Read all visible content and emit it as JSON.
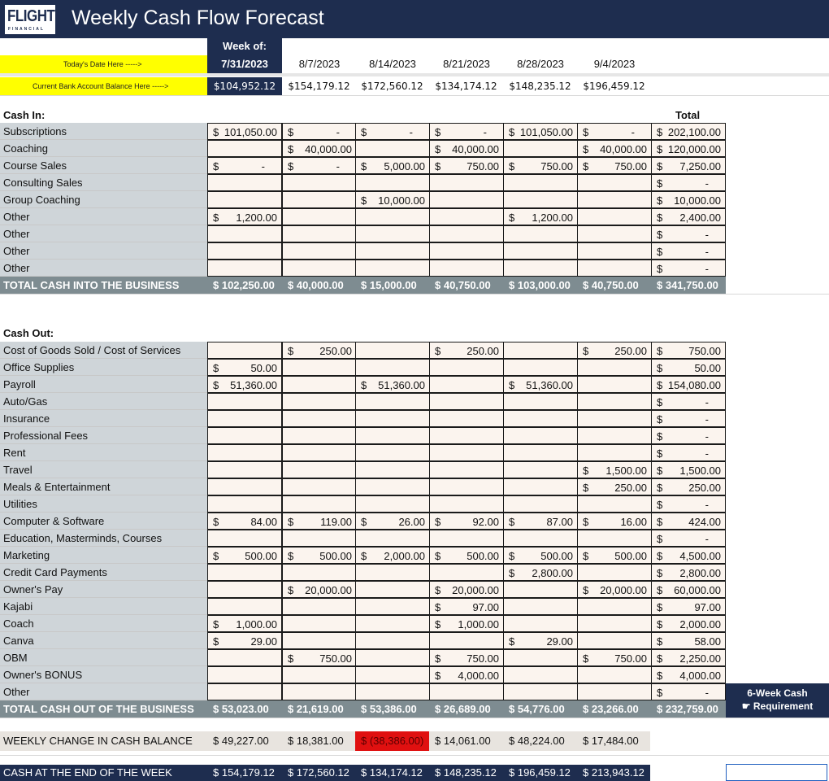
{
  "header": {
    "title": "Weekly Cash Flow Forecast",
    "logo_main": "FLIGHT",
    "logo_sub": "FINANCIAL"
  },
  "prompts": {
    "date": "Today's Date Here ----->",
    "balance": "Current Bank Account Balance Here ----->"
  },
  "week_of_label": "Week of:",
  "weeks": [
    "7/31/2023",
    "8/7/2023",
    "8/14/2023",
    "8/21/2023",
    "8/28/2023",
    "9/4/2023"
  ],
  "opening_balances": [
    "$104,952.12",
    "$154,179.12",
    "$172,560.12",
    "$134,174.12",
    "$148,235.12",
    "$196,459.12"
  ],
  "total_label": "Total",
  "cash_in": {
    "label": "Cash In:",
    "rows": [
      {
        "name": "Subscriptions",
        "cells": [
          [
            "$",
            "101,050.00"
          ],
          [
            "$",
            "-"
          ],
          [
            "$",
            "-"
          ],
          [
            "$",
            "-"
          ],
          [
            "$",
            "101,050.00"
          ],
          [
            "$",
            "-"
          ],
          [
            "$",
            "202,100.00"
          ]
        ]
      },
      {
        "name": "Coaching",
        "cells": [
          null,
          [
            "$",
            "40,000.00"
          ],
          null,
          [
            "$",
            "40,000.00"
          ],
          null,
          [
            "$",
            "40,000.00"
          ],
          [
            "$",
            "120,000.00"
          ]
        ]
      },
      {
        "name": "Course Sales",
        "cells": [
          [
            "$",
            "-"
          ],
          [
            "$",
            "-"
          ],
          [
            "$",
            "5,000.00"
          ],
          [
            "$",
            "750.00"
          ],
          [
            "$",
            "750.00"
          ],
          [
            "$",
            "750.00"
          ],
          [
            "$",
            "7,250.00"
          ]
        ]
      },
      {
        "name": "Consulting Sales",
        "cells": [
          null,
          null,
          null,
          null,
          null,
          null,
          [
            "$",
            "-"
          ]
        ]
      },
      {
        "name": "Group Coaching",
        "cells": [
          null,
          null,
          [
            "$",
            "10,000.00"
          ],
          null,
          null,
          null,
          [
            "$",
            "10,000.00"
          ]
        ]
      },
      {
        "name": "Other",
        "cells": [
          [
            "$",
            "1,200.00"
          ],
          null,
          null,
          null,
          [
            "$",
            "1,200.00"
          ],
          null,
          [
            "$",
            "2,400.00"
          ]
        ]
      },
      {
        "name": "Other",
        "cells": [
          null,
          null,
          null,
          null,
          null,
          null,
          [
            "$",
            "-"
          ]
        ]
      },
      {
        "name": "Other",
        "cells": [
          null,
          null,
          null,
          null,
          null,
          null,
          [
            "$",
            "-"
          ]
        ]
      },
      {
        "name": "Other",
        "cells": [
          null,
          null,
          null,
          null,
          null,
          null,
          [
            "$",
            "-"
          ]
        ]
      }
    ],
    "total": {
      "label": "TOTAL CASH INTO THE BUSINESS",
      "values": [
        "$ 102,250.00",
        "$ 40,000.00",
        "$ 15,000.00",
        "$ 40,750.00",
        "$ 103,000.00",
        "$ 40,750.00",
        "$ 341,750.00"
      ]
    }
  },
  "cash_out": {
    "label": "Cash Out:",
    "rows": [
      {
        "name": "Cost of Goods Sold / Cost of Services",
        "cells": [
          null,
          [
            "$",
            "250.00"
          ],
          null,
          [
            "$",
            "250.00"
          ],
          null,
          [
            "$",
            "250.00"
          ],
          [
            "$",
            "750.00"
          ]
        ]
      },
      {
        "name": "Office Supplies",
        "cells": [
          [
            "$",
            "50.00"
          ],
          null,
          null,
          null,
          null,
          null,
          [
            "$",
            "50.00"
          ]
        ]
      },
      {
        "name": "Payroll",
        "cells": [
          [
            "$",
            "51,360.00"
          ],
          null,
          [
            "$",
            "51,360.00"
          ],
          null,
          [
            "$",
            "51,360.00"
          ],
          null,
          [
            "$",
            "154,080.00"
          ]
        ]
      },
      {
        "name": "Auto/Gas",
        "cells": [
          null,
          null,
          null,
          null,
          null,
          null,
          [
            "$",
            "-"
          ]
        ]
      },
      {
        "name": "Insurance",
        "cells": [
          null,
          null,
          null,
          null,
          null,
          null,
          [
            "$",
            "-"
          ]
        ]
      },
      {
        "name": "Professional Fees",
        "cells": [
          null,
          null,
          null,
          null,
          null,
          null,
          [
            "$",
            "-"
          ]
        ]
      },
      {
        "name": "Rent",
        "cells": [
          null,
          null,
          null,
          null,
          null,
          null,
          [
            "$",
            "-"
          ]
        ]
      },
      {
        "name": "Travel",
        "cells": [
          null,
          null,
          null,
          null,
          null,
          [
            "$",
            "1,500.00"
          ],
          [
            "$",
            "1,500.00"
          ]
        ]
      },
      {
        "name": "Meals & Entertainment",
        "cells": [
          null,
          null,
          null,
          null,
          null,
          [
            "$",
            "250.00"
          ],
          [
            "$",
            "250.00"
          ]
        ]
      },
      {
        "name": "Utilities",
        "cells": [
          null,
          null,
          null,
          null,
          null,
          null,
          [
            "$",
            "-"
          ]
        ]
      },
      {
        "name": "Computer & Software",
        "cells": [
          [
            "$",
            "84.00"
          ],
          [
            "$",
            "119.00"
          ],
          [
            "$",
            "26.00"
          ],
          [
            "$",
            "92.00"
          ],
          [
            "$",
            "87.00"
          ],
          [
            "$",
            "16.00"
          ],
          [
            "$",
            "424.00"
          ]
        ]
      },
      {
        "name": "Education, Masterminds, Courses",
        "cells": [
          null,
          null,
          null,
          null,
          null,
          null,
          [
            "$",
            "-"
          ]
        ]
      },
      {
        "name": "Marketing",
        "cells": [
          [
            "$",
            "500.00"
          ],
          [
            "$",
            "500.00"
          ],
          [
            "$",
            "2,000.00"
          ],
          [
            "$",
            "500.00"
          ],
          [
            "$",
            "500.00"
          ],
          [
            "$",
            "500.00"
          ],
          [
            "$",
            "4,500.00"
          ]
        ]
      },
      {
        "name": "Credit Card Payments",
        "cells": [
          null,
          null,
          null,
          null,
          [
            "$",
            "2,800.00"
          ],
          null,
          [
            "$",
            "2,800.00"
          ]
        ]
      },
      {
        "name": "Owner's Pay",
        "cells": [
          null,
          [
            "$",
            "20,000.00"
          ],
          null,
          [
            "$",
            "20,000.00"
          ],
          null,
          [
            "$",
            "20,000.00"
          ],
          [
            "$",
            "60,000.00"
          ]
        ]
      },
      {
        "name": "Kajabi",
        "cells": [
          null,
          null,
          null,
          [
            "$",
            "97.00"
          ],
          null,
          null,
          [
            "$",
            "97.00"
          ]
        ]
      },
      {
        "name": "Coach",
        "cells": [
          [
            "$",
            "1,000.00"
          ],
          null,
          null,
          [
            "$",
            "1,000.00"
          ],
          null,
          null,
          [
            "$",
            "2,000.00"
          ]
        ]
      },
      {
        "name": "Canva",
        "cells": [
          [
            "$",
            "29.00"
          ],
          null,
          null,
          null,
          [
            "$",
            "29.00"
          ],
          null,
          [
            "$",
            "58.00"
          ]
        ]
      },
      {
        "name": "OBM",
        "cells": [
          null,
          [
            "$",
            "750.00"
          ],
          null,
          [
            "$",
            "750.00"
          ],
          null,
          [
            "$",
            "750.00"
          ],
          [
            "$",
            "2,250.00"
          ]
        ]
      },
      {
        "name": "Owner's BONUS",
        "cells": [
          null,
          null,
          null,
          [
            "$",
            "4,000.00"
          ],
          null,
          null,
          [
            "$",
            "4,000.00"
          ]
        ]
      },
      {
        "name": "Other",
        "cells": [
          null,
          null,
          null,
          null,
          null,
          null,
          [
            "$",
            "-"
          ]
        ]
      }
    ],
    "total": {
      "label": "TOTAL CASH OUT OF THE BUSINESS",
      "values": [
        "$ 53,023.00",
        "$ 21,619.00",
        "$ 53,386.00",
        "$ 26,689.00",
        "$ 54,776.00",
        "$ 23,266.00",
        "$ 232,759.00"
      ]
    }
  },
  "weekly_change": {
    "label": "WEEKLY CHANGE IN CASH BALANCE",
    "values": [
      "$ 49,227.00",
      "$ 18,381.00",
      "$ (38,386.00)",
      "$ 14,061.00",
      "$ 48,224.00",
      "$ 17,484.00"
    ]
  },
  "end_of_week": {
    "label": "CASH AT THE END OF THE WEEK",
    "values": [
      "$ 154,179.12",
      "$ 172,560.12",
      "$ 134,174.12",
      "$ 148,235.12",
      "$ 196,459.12",
      "$ 213,943.12"
    ]
  },
  "requirement": {
    "line1": "6-Week Cash",
    "line2": "Requirement",
    "pointer_icon": "pointing-hand-icon"
  },
  "colors": {
    "navy": "#1e2d4f",
    "label_gray": "#cfd5d9",
    "total_band": "#7e8c91",
    "cell_bg": "#fbf4ee",
    "prompt_yellow": "#ffff00",
    "negative_red": "#e01010"
  }
}
